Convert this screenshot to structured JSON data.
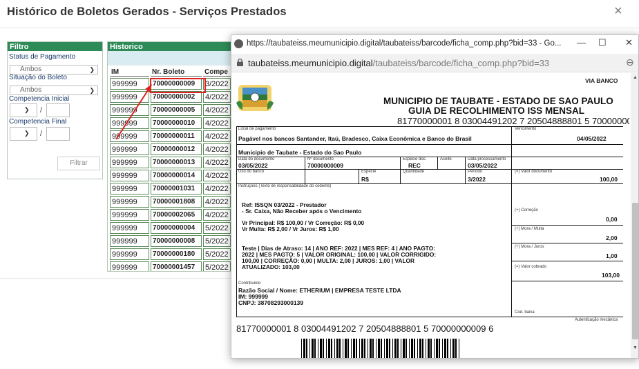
{
  "modal": {
    "title": "Histórico de Boletos Gerados - Serviços Prestados",
    "close": "×"
  },
  "filter": {
    "title": "Filtro",
    "status_label": "Status de Pagamento",
    "status_value": "Ambos",
    "situacao_label": "Situação do Boleto",
    "situacao_value": "Ambos",
    "comp_inicial_label": "Competencia Inicial",
    "comp_final_label": "Competencia Final",
    "slash": "/",
    "button": "Filtrar"
  },
  "historico": {
    "title": "Historico",
    "columns": [
      "IM",
      "Nr. Boleto",
      "Compe"
    ],
    "rows": [
      {
        "im": "999999",
        "nr": "70000000009",
        "comp": "3/2022"
      },
      {
        "im": "999999",
        "nr": "70000000002",
        "comp": "4/2022"
      },
      {
        "im": "999999",
        "nr": "70000000005",
        "comp": "4/2022"
      },
      {
        "im": "999999",
        "nr": "70000000010",
        "comp": "4/2022"
      },
      {
        "im": "999999",
        "nr": "70000000011",
        "comp": "4/2022"
      },
      {
        "im": "999999",
        "nr": "70000000012",
        "comp": "4/2022"
      },
      {
        "im": "999999",
        "nr": "70000000013",
        "comp": "4/2022"
      },
      {
        "im": "999999",
        "nr": "70000000014",
        "comp": "4/2022"
      },
      {
        "im": "999999",
        "nr": "70000001031",
        "comp": "4/2022"
      },
      {
        "im": "999999",
        "nr": "70000001808",
        "comp": "4/2022"
      },
      {
        "im": "999999",
        "nr": "70000002065",
        "comp": "4/2022"
      },
      {
        "im": "999999",
        "nr": "70000000004",
        "comp": "5/2022"
      },
      {
        "im": "999999",
        "nr": "70000000008",
        "comp": "5/2022"
      },
      {
        "im": "999999",
        "nr": "70000000180",
        "comp": "5/2022"
      },
      {
        "im": "999999",
        "nr": "70000001457",
        "comp": "5/2022"
      }
    ]
  },
  "popup": {
    "title": "https://taubateiss.meumunicipio.digital/taubateiss/barcode/ficha_comp.php?bid=33 - Go...",
    "minimize": "—",
    "maximize": "☐",
    "close": "✕",
    "url_host": "taubateiss.meumunicipio.digital",
    "url_path": "/taubateiss/barcode/ficha_comp.php?bid=33",
    "zoom": "⊖"
  },
  "boleto": {
    "via": "VIA BANCO",
    "municipio": "MUNICIPIO DE TAUBATE - ESTADO DE SAO PAULO",
    "guia": "GUIA DE RECOLHIMENTO ISS MENSAL",
    "linha_digitavel": "81770000001 8 03004491202 7 20504888801 5 70000000009 6",
    "local_label": "Local de pagamento",
    "local_value": "Pagável nos bancos Santander, Itaú, Bradesco, Caixa Econômica e Banco do Brasil",
    "vencimento_label": "Vencimento",
    "vencimento_value": "04/05/2022",
    "cedente_value": "Municipio de Taubate - Estado do Sao Paulo",
    "data_doc_label": "Data do documento",
    "data_doc_value": "03/05/2022",
    "nr_doc_label": "Nº documento",
    "nr_doc_value": "70000000009",
    "especie_doc_label": "Espécie doc.",
    "especie_doc_value": "REC",
    "aceite_label": "Aceite",
    "data_proc_label": "Data processamento",
    "data_proc_value": "03/05/2022",
    "uso_banco_label": "Uso do banco",
    "especie_label": "Espécie",
    "especie_value": "R$",
    "quantidade_label": "Quantidade",
    "periodo_label": "Período",
    "periodo_value": "3/2022",
    "valor_doc_label": "(=) Valor documento",
    "valor_doc_value": "100,00",
    "instr_label": "Instruções (Texto de responsabilidade do cedente)",
    "instr_lines": [
      "Ref: ISSQN 03/2022 - Prestador",
      "- Sr. Caixa, Não Receber após o Vencimento",
      "Vr Principal: R$ 100,00 / Vr Correção: R$ 0,00",
      "Vr Multa:    R$ 2,00 / Vr Juros:    R$ 1,00",
      "Teste | Dias de Atraso: 14 | ANO REF: 2022 | MES REF: 4 | ANO PAGTO:",
      "2022 | MES PAGTO: 5 | VALOR ORIGINAL: 100,00 | VALOR CORRIGIDO:",
      "100,00 | CORREÇÃO: 0,00 | MULTA: 2,00 | JUROS: 1,00 | VALOR",
      "ATUALIZADO: 103,00"
    ],
    "correcao_label": "(+) Correção",
    "correcao_value": "0,00",
    "mora_multa_label": "(+) Mora / Multa",
    "mora_multa_value": "2,00",
    "mora_juros_label": "(+) Mora / Juros",
    "mora_juros_value": "1,00",
    "valor_cobrado_label": "(=) Valor cobrado",
    "valor_cobrado_value": "103,00",
    "contribuinte_label": "Contribuinte",
    "razao": "Razão Social / Nome: ETHERIUM | EMPRESA TESTE LTDA",
    "im": "IM: 999999",
    "cnpj": "CNPJ: 38708293000139",
    "cod_baixa_label": "Cod. baixa",
    "autenticacao_label": "Autenticação mecânica"
  }
}
